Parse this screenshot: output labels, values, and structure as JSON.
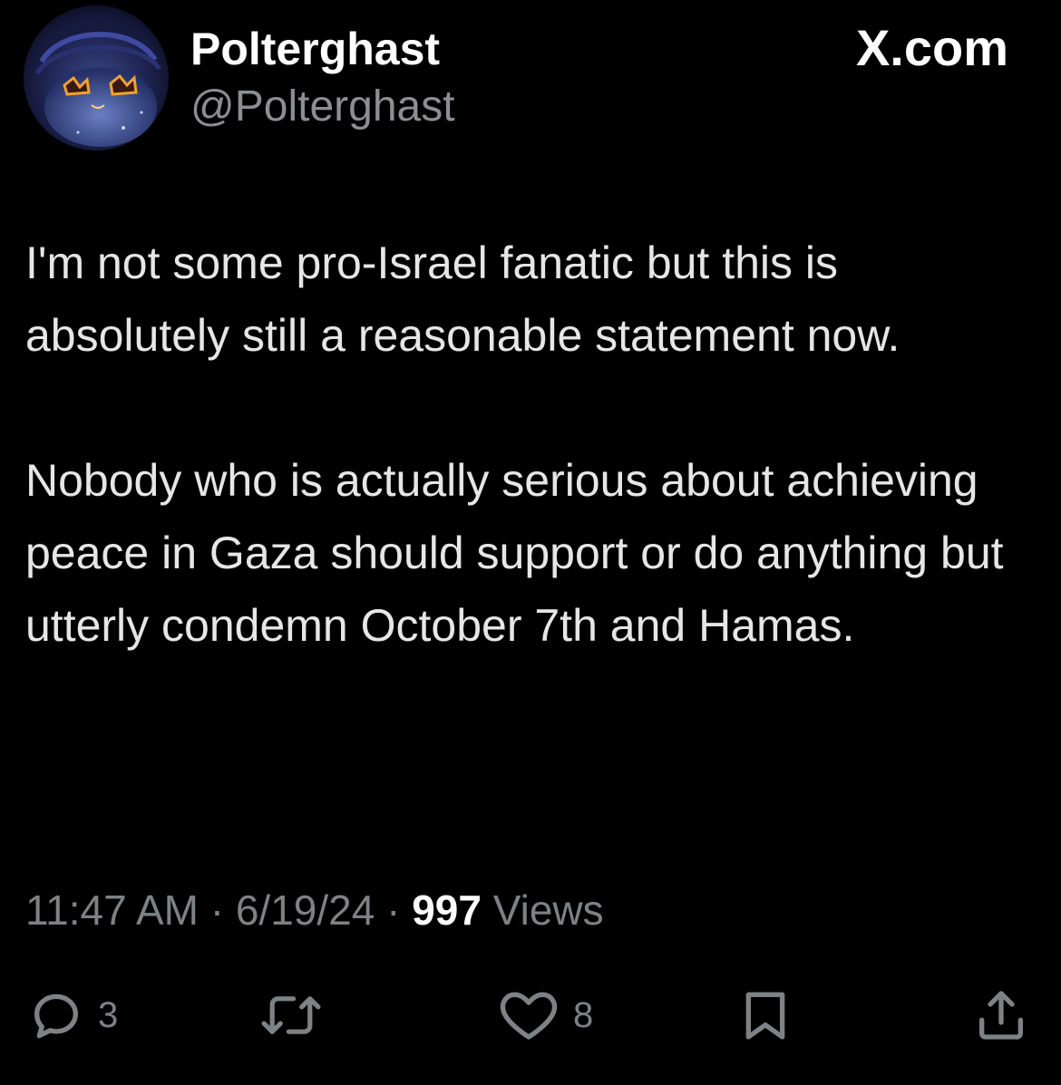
{
  "header": {
    "display_name": "Polterghast",
    "handle": "@Polterghast",
    "brand": "X.com",
    "avatar_icon": "ghost-character-avatar"
  },
  "tweet": {
    "paragraphs": [
      "I'm not some pro-Israel fanatic but this is absolutely still a reasonable statement now.",
      "Nobody who is actually serious about achieving peace in Gaza should support or do anything but utterly condemn October 7th and Hamas."
    ],
    "time": "11:47 AM",
    "separator": "·",
    "date": "6/19/24",
    "views_count": "997",
    "views_label": "Views"
  },
  "actions": {
    "reply": {
      "icon": "reply-icon",
      "count": "3"
    },
    "retweet": {
      "icon": "retweet-icon",
      "count": ""
    },
    "like": {
      "icon": "heart-icon",
      "count": "8"
    },
    "bookmark": {
      "icon": "bookmark-icon"
    },
    "share": {
      "icon": "share-icon"
    }
  },
  "colors": {
    "background": "#000000",
    "text": "#e7e9ea",
    "secondary": "#7d8287"
  }
}
